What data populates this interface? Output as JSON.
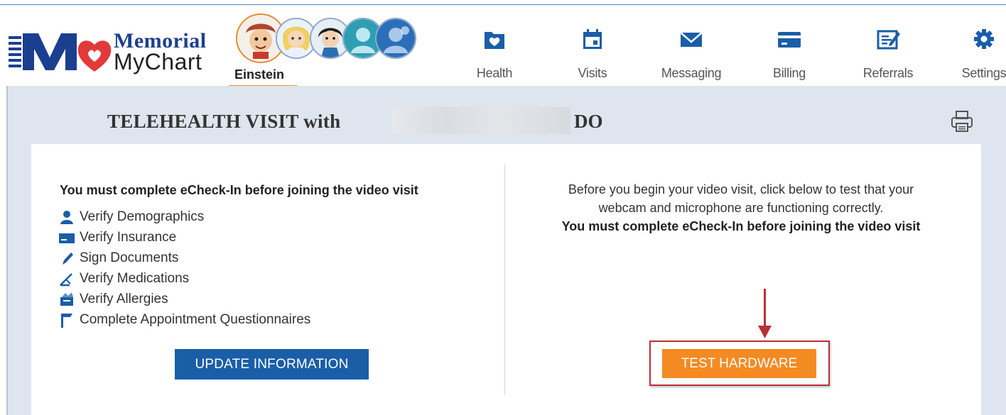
{
  "brand": {
    "line1": "Memorial",
    "line2": "MyChart",
    "colors": {
      "blue": "#1b3f8f",
      "red": "#e23a3a"
    }
  },
  "account": {
    "name": "Einstein"
  },
  "nav": [
    {
      "label": "Health",
      "icon": "folder-heart-icon"
    },
    {
      "label": "Visits",
      "icon": "calendar-icon"
    },
    {
      "label": "Messaging",
      "icon": "envelope-icon"
    },
    {
      "label": "Billing",
      "icon": "credit-card-icon"
    },
    {
      "label": "Referrals",
      "icon": "edit-document-icon"
    },
    {
      "label": "Settings",
      "icon": "gear-icon"
    }
  ],
  "visit": {
    "title_prefix": "TELEHEALTH VISIT with",
    "title_suffix": "DO"
  },
  "left_panel": {
    "heading": "You must complete eCheck-In before joining the video visit",
    "items": [
      {
        "label": "Verify Demographics",
        "icon": "person-icon"
      },
      {
        "label": "Verify Insurance",
        "icon": "insurance-card-icon"
      },
      {
        "label": "Sign Documents",
        "icon": "pen-icon"
      },
      {
        "label": "Verify Medications",
        "icon": "medication-icon"
      },
      {
        "label": "Verify Allergies",
        "icon": "allergies-icon"
      },
      {
        "label": "Complete Appointment Questionnaires",
        "icon": "questionnaire-icon"
      }
    ],
    "button": "UPDATE INFORMATION"
  },
  "right_panel": {
    "line1": "Before you begin your video visit, click below to test that your",
    "line2": "webcam and microphone are functioning correctly.",
    "line3": "You must complete eCheck-In before joining the video visit",
    "button": "TEST HARDWARE",
    "accent": "#f48a22",
    "highlight": "#b83038"
  }
}
